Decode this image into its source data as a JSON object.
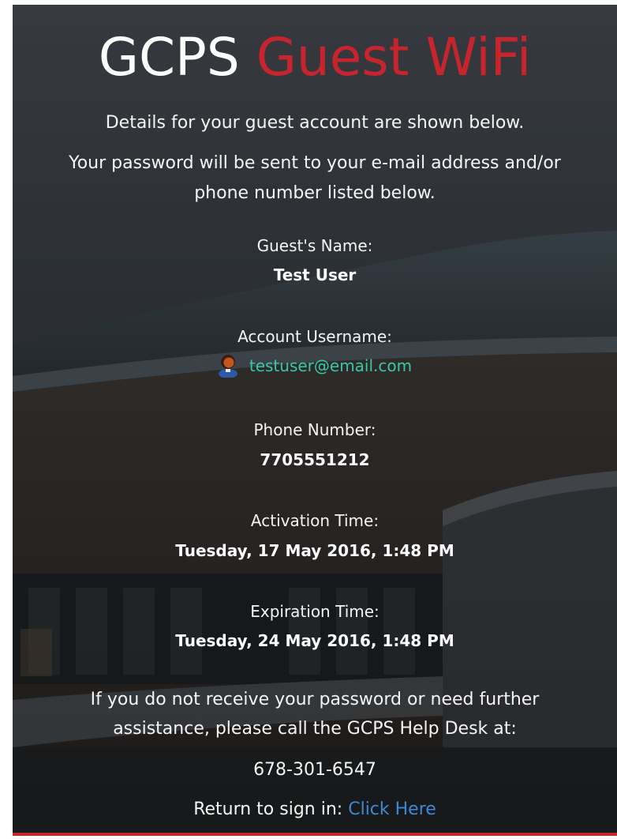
{
  "header": {
    "title_part1": "GCPS",
    "title_part2": "Guest WiFi"
  },
  "intro": {
    "line1": "Details for your guest account are shown below.",
    "line2a": "Your password will be sent to your e-mail address and/or",
    "line2b": "phone number listed below."
  },
  "details": {
    "guest_name_label": "Guest's Name:",
    "guest_name": "Test User",
    "username_label": "Account Username:",
    "username": "testuser@email.com",
    "username_icon": "user-icon",
    "phone_label": "Phone Number:",
    "phone": "7705551212",
    "activation_label": "Activation Time:",
    "activation": "Tuesday, 17 May 2016, 1:48 PM",
    "expiration_label": "Expiration Time:",
    "expiration": "Tuesday, 24 May 2016, 1:48 PM"
  },
  "help": {
    "line1": "If you do not receive your password or need further",
    "line2": "assistance, please call the GCPS Help Desk at:",
    "phone": "678-301-6547"
  },
  "footer": {
    "return_label": "Return to sign in:",
    "return_link": "Click Here"
  },
  "colors": {
    "brand_red": "#c8242e",
    "email_green": "#37c9a6",
    "link_blue": "#3a8bd6"
  }
}
